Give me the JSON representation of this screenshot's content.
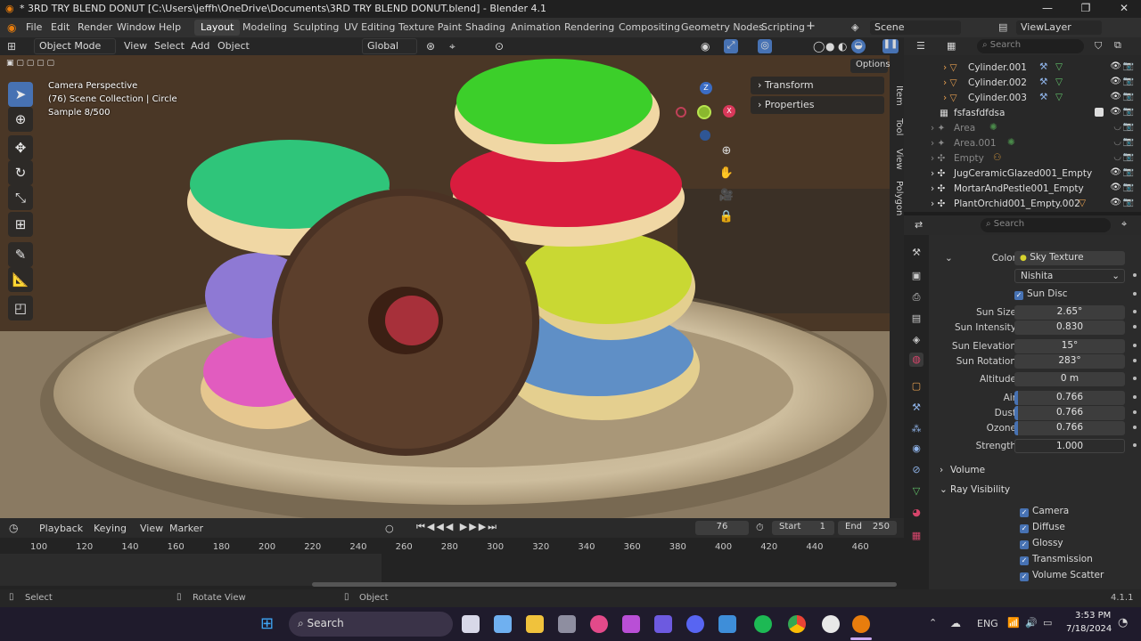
{
  "window": {
    "title": "* 3RD TRY BLEND DONUT [C:\\Users\\jeffh\\OneDrive\\Documents\\3RD TRY BLEND DONUT.blend] - Blender 4.1",
    "min": "—",
    "max": "❐",
    "close": "✕"
  },
  "menu": {
    "file": "File",
    "edit": "Edit",
    "render": "Render",
    "window": "Window",
    "help": "Help"
  },
  "workspaces": [
    "Layout",
    "Modeling",
    "Sculpting",
    "UV Editing",
    "Texture Paint",
    "Shading",
    "Animation",
    "Rendering",
    "Compositing",
    "Geometry Nodes",
    "Scripting"
  ],
  "add_workspace": "+",
  "scene": {
    "name": "Scene",
    "view_layer": "ViewLayer"
  },
  "viewport_header": {
    "mode": "Object Mode",
    "view": "View",
    "select": "Select",
    "add": "Add",
    "object": "Object",
    "orientation": "Global",
    "options": "Options"
  },
  "viewport_overlay": {
    "line1": "Camera Perspective",
    "line2": "(76) Scene Collection | Circle",
    "line3": "Sample 8/500"
  },
  "gizmo": {
    "z": "Z",
    "x": "X"
  },
  "npanel": {
    "transform": "Transform",
    "properties": "Properties"
  },
  "n_tabs": [
    "Item",
    "Tool",
    "View",
    "Polygon"
  ],
  "timeline": {
    "playback": "Playback",
    "keying": "Keying",
    "view": "View",
    "marker": "Marker",
    "current_frame": "76",
    "start_label": "Start",
    "start": "1",
    "end_label": "End",
    "end": "250",
    "ticks": [
      "100",
      "120",
      "140",
      "160",
      "180",
      "200",
      "220",
      "240",
      "260",
      "280",
      "300",
      "320",
      "340",
      "360",
      "380",
      "400",
      "420",
      "440",
      "460"
    ]
  },
  "status": {
    "select": "Select",
    "rotate": "Rotate View",
    "object": "Object",
    "version": "4.1.1"
  },
  "outliner": {
    "search_placeholder": "Search",
    "items": [
      {
        "name": "Cylinder.001"
      },
      {
        "name": "Cylinder.002"
      },
      {
        "name": "Cylinder.003"
      },
      {
        "name": "fsfasfdfdsa"
      },
      {
        "name": "Area"
      },
      {
        "name": "Area.001"
      },
      {
        "name": "Empty"
      },
      {
        "name": "JugCeramicGlazed001_Empty"
      },
      {
        "name": "MortarAndPestle001_Empty"
      },
      {
        "name": "PlantOrchid001_Empty.002"
      }
    ]
  },
  "properties": {
    "search_placeholder": "Search",
    "color_label": "Color",
    "color_value": "Sky Texture",
    "sky_type": "Nishita",
    "sun_disc": "Sun Disc",
    "fields": [
      {
        "label": "Sun Size",
        "value": "2.65°"
      },
      {
        "label": "Sun Intensity",
        "value": "0.830"
      },
      {
        "label": "Sun Elevation",
        "value": "15°"
      },
      {
        "label": "Sun Rotation",
        "value": "283°"
      },
      {
        "label": "Altitude",
        "value": "0 m"
      },
      {
        "label": "Air",
        "value": "0.766"
      },
      {
        "label": "Dust",
        "value": "0.766"
      },
      {
        "label": "Ozone",
        "value": "0.766"
      },
      {
        "label": "Strength",
        "value": "1.000"
      }
    ],
    "volume": "Volume",
    "ray_visibility": "Ray Visibility",
    "rays": [
      "Camera",
      "Diffuse",
      "Glossy",
      "Transmission",
      "Volume Scatter"
    ]
  },
  "taskbar": {
    "search": "Search",
    "lang": "ENG",
    "time": "3:53 PM",
    "date": "7/18/2024"
  }
}
